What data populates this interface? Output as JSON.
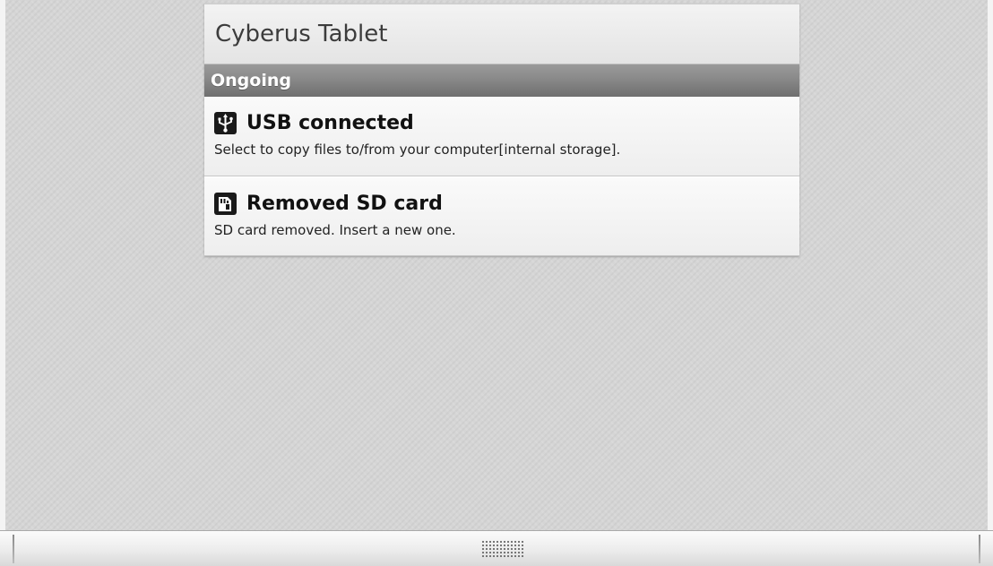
{
  "panel": {
    "title": "Cyberus Tablet",
    "section_header": "Ongoing",
    "notifications": [
      {
        "icon": "usb-icon",
        "title": "USB connected",
        "text": "Select to copy files to/from your computer[internal storage]."
      },
      {
        "icon": "sd-card-icon",
        "title": "Removed SD card",
        "text": "SD card removed. Insert a new one."
      }
    ]
  },
  "navbar": {
    "handle_icon": "grip-handle-icon"
  },
  "colors": {
    "background": "#d5d5d5",
    "section_header": "#8b8b8b",
    "panel_title_text": "#3c3c3c",
    "notification_bg": "#f4f4f4"
  }
}
